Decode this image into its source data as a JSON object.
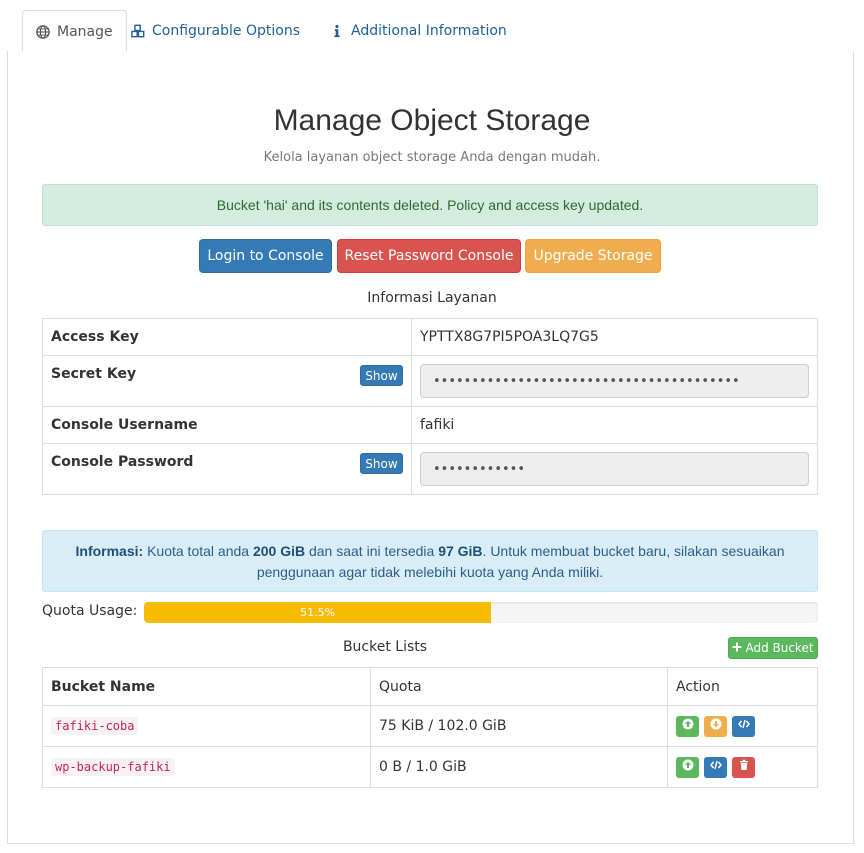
{
  "tabs": [
    {
      "label": "Manage",
      "icon": "globe-icon"
    },
    {
      "label": "Configurable Options",
      "icon": "cubes-icon"
    },
    {
      "label": "Additional Information",
      "icon": "info-icon"
    }
  ],
  "header": {
    "title": "Manage Object Storage",
    "subtitle": "Kelola layanan object storage Anda dengan mudah."
  },
  "alert_success": "Bucket 'hai' and its contents deleted. Policy and access key updated.",
  "actions": {
    "login": "Login to Console",
    "reset": "Reset Password Console",
    "upgrade": "Upgrade Storage"
  },
  "service_info": {
    "heading": "Informasi Layanan",
    "show_label": "Show",
    "rows": [
      {
        "label": "Access Key",
        "value": "YPTTX8G7PI5POA3LQ7G5"
      },
      {
        "label": "Secret Key",
        "value": "••••••••••••••••••••••••••••••••••••••••"
      },
      {
        "label": "Console Username",
        "value": "fafiki"
      },
      {
        "label": "Console Password",
        "value": "••••••••••••"
      }
    ]
  },
  "quota_info": {
    "prefix": "Informasi:",
    "text1": " Kuota total anda ",
    "total": "200 GiB",
    "text2": " dan saat ini tersedia ",
    "available": "97 GiB",
    "text3": ". Untuk membuat bucket baru, silakan sesuaikan penggunaan agar tidak melebihi kuota yang Anda miliki."
  },
  "quota_usage": {
    "label": "Quota Usage:",
    "percent": 51.5,
    "percent_text": "51.5%"
  },
  "buckets": {
    "heading": "Bucket Lists",
    "add_label": "Add Bucket",
    "columns": [
      "Bucket Name",
      "Quota",
      "Action"
    ],
    "rows": [
      {
        "name": "fafiki-coba",
        "quota": "75 KiB / 102.0 GiB"
      },
      {
        "name": "wp-backup-fafiki",
        "quota": "0 B / 1.0 GiB"
      }
    ]
  },
  "colors": {
    "primary": "#337ab7",
    "danger": "#d9534f",
    "warning": "#f0ad4e",
    "success": "#5cb85c",
    "progress": "#f7bc00"
  }
}
